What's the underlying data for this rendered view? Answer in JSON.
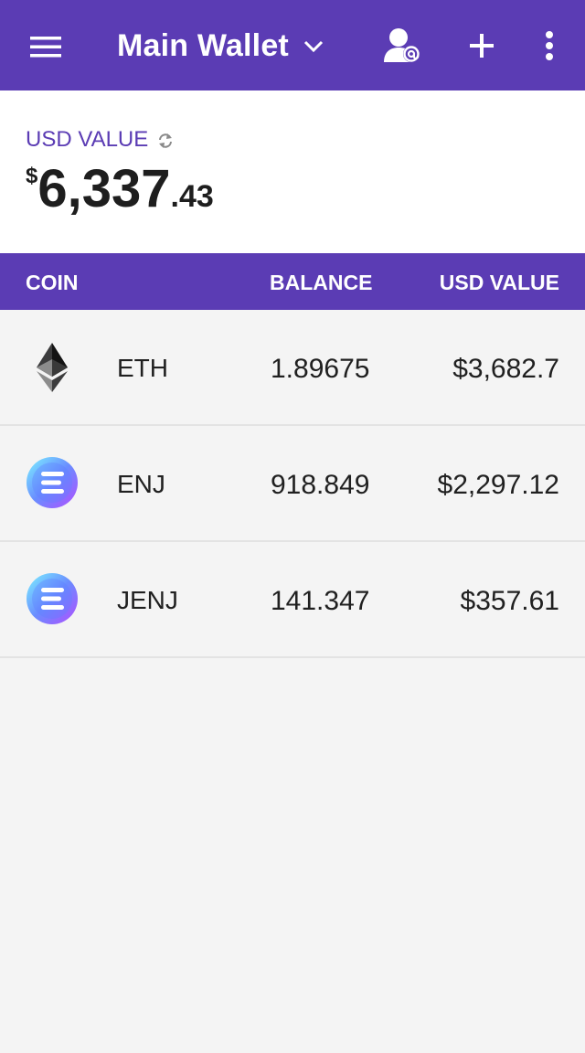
{
  "header": {
    "wallet_name": "Main Wallet",
    "icons": [
      "menu-icon",
      "chevron-down-icon",
      "contact-at-icon",
      "plus-icon",
      "more-vert-icon"
    ],
    "background_color": "#5b3cb4"
  },
  "summary": {
    "label": "USD VALUE",
    "currency_symbol": "$",
    "total_integer": "6,337",
    "total_decimal": ".43"
  },
  "table": {
    "headers": {
      "coin": "COIN",
      "balance": "BALANCE",
      "usd_value": "USD VALUE"
    },
    "rows": [
      {
        "symbol": "ETH",
        "balance": "1.89675",
        "usd_value": "$3,682.7",
        "icon": "ethereum-icon"
      },
      {
        "symbol": "ENJ",
        "balance": "918.849",
        "usd_value": "$2,297.12",
        "icon": "enjin-icon"
      },
      {
        "symbol": "JENJ",
        "balance": "141.347",
        "usd_value": "$357.61",
        "icon": "enjin-icon"
      }
    ]
  }
}
